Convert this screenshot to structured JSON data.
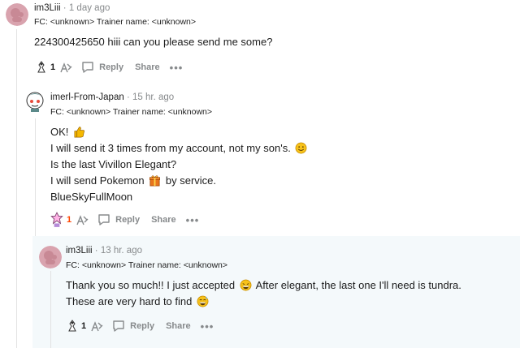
{
  "comments": [
    {
      "user": "im3Liii",
      "sep": "·",
      "time": "1 day ago",
      "flair": "FC: <unknown> Trainer name: <unknown>",
      "lines": [
        "224300425650 hiii can you please send me some?"
      ],
      "award_count": "1",
      "reply_label": "Reply",
      "share_label": "Share",
      "more_label": "•••"
    },
    {
      "user": "imerl-From-Japan",
      "sep": "·",
      "time": "15 hr. ago",
      "flair": "FC: <unknown> Trainer name: <unknown>",
      "lines": [
        "OK!",
        "I will send it 3 times from my account, not my son's.",
        "Is the last Vivillon Elegant?",
        "I will send Pokemon",
        "by service.",
        "BlueSkyFullMoon"
      ],
      "award_count": "1",
      "reply_label": "Reply",
      "share_label": "Share",
      "more_label": "•••"
    },
    {
      "user": "im3Liii",
      "sep": "·",
      "time": "13 hr. ago",
      "flair": "FC: <unknown> Trainer name: <unknown>",
      "lines": [
        "Thank you so much!! I just accepted",
        "After elegant, the last one I'll need is tundra.",
        "These are very hard to find"
      ],
      "award_count": "1",
      "reply_label": "Reply",
      "share_label": "Share",
      "more_label": "•••"
    }
  ],
  "colors": {
    "accent_orange": "#ff4500",
    "meta_gray": "#878a8c",
    "nested_bg": "#f4f9fb",
    "avatar_pink": "#d9a3ae"
  }
}
